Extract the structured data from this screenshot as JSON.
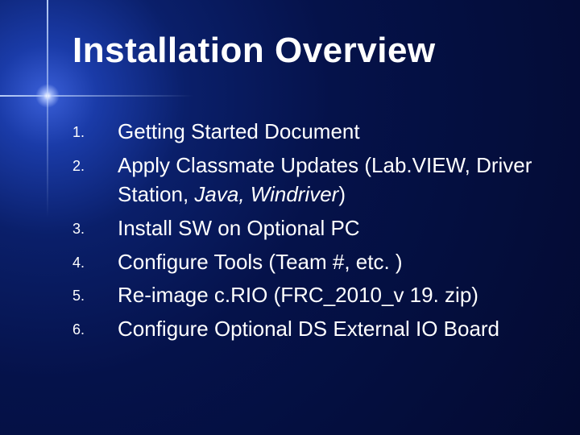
{
  "title": "Installation Overview",
  "items": [
    {
      "num": "1.",
      "text": "Getting Started Document"
    },
    {
      "num": "2.",
      "text_html": "Apply Classmate Updates (Lab.VIEW, Driver Station, <span class=\"italic\">Java, Windriver</span>)"
    },
    {
      "num": "3.",
      "text": "Install SW on Optional PC"
    },
    {
      "num": "4.",
      "text": "Configure Tools (Team #, etc. )"
    },
    {
      "num": "5.",
      "text": "Re-image c.RIO (FRC_2010_v 19. zip)"
    },
    {
      "num": "6.",
      "text": "Configure Optional DS External IO Board"
    }
  ]
}
